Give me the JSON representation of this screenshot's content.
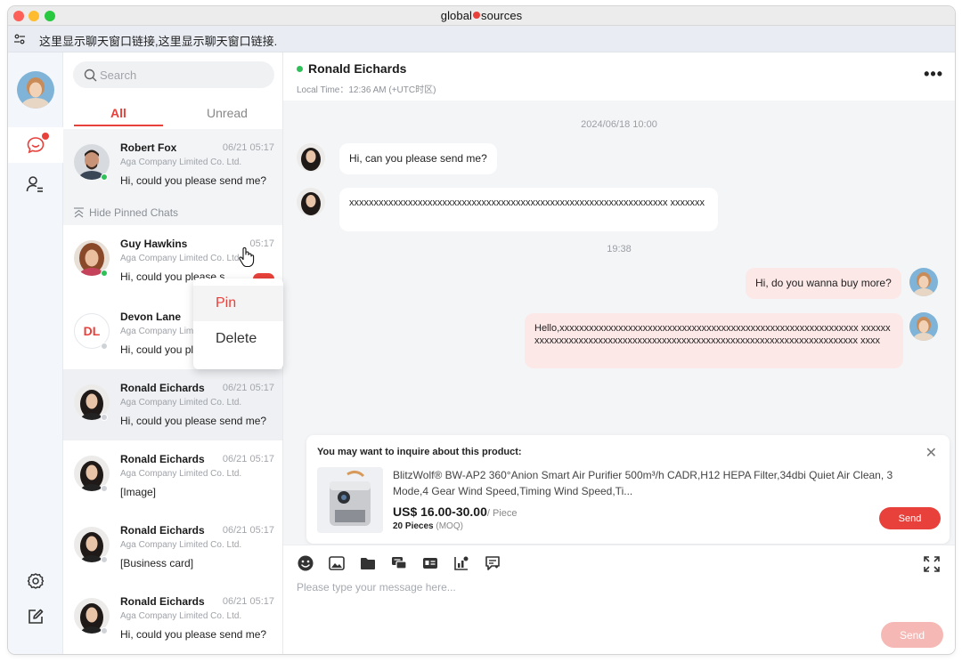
{
  "window": {
    "brand_left": "global",
    "brand_right": "sources"
  },
  "linkbar": {
    "text": "这里显示聊天窗口链接,这里显示聊天窗口链接."
  },
  "search": {
    "placeholder": "Search"
  },
  "tabs": {
    "all": "All",
    "unread": "Unread"
  },
  "pinned_chat": {
    "name": "Robert Fox",
    "time": "06/21 05:17",
    "company": "Aga Company Limited Co. Ltd.",
    "message": "Hi, could you please send me?",
    "status": "online"
  },
  "hide_pinned_label": "Hide Pinned Chats",
  "chats": [
    {
      "name": "Guy Hawkins",
      "time": "05:17",
      "company": "Aga Company Limited Co. Ltd.",
      "message": "Hi, could you please s...",
      "status": "online"
    },
    {
      "name": "Devon Lane",
      "time": "",
      "company": "Aga Company Lim",
      "message": "Hi, could you pl",
      "status": "offline",
      "initials": "DL"
    },
    {
      "name": "Ronald Eichards",
      "time": "06/21 05:17",
      "company": "Aga Company Limited Co. Ltd.",
      "message": "Hi, could you please send me?",
      "status": "offline"
    },
    {
      "name": "Ronald Eichards",
      "time": "06/21 05:17",
      "company": "Aga Company Limited Co. Ltd.",
      "message": "[Image]",
      "status": "offline"
    },
    {
      "name": "Ronald Eichards",
      "time": "06/21 05:17",
      "company": "Aga Company Limited Co. Ltd.",
      "message": "[Business card]",
      "status": "offline"
    },
    {
      "name": "Ronald Eichards",
      "time": "06/21 05:17",
      "company": "Aga Company Limited Co. Ltd.",
      "message": "Hi, could you please send me?",
      "status": "offline"
    }
  ],
  "context_menu": {
    "pin": "Pin",
    "delete": "Delete"
  },
  "conversation": {
    "name": "Ronald Eichards",
    "local_time": "Local Time：12:36 AM (+UTC时区)",
    "more": "•••",
    "stamp1": "2024/06/18 10:00",
    "stamp2": "19:38",
    "messages": [
      {
        "from": "them",
        "text": "Hi, can you please send me?"
      },
      {
        "from": "them",
        "text": "xxxxxxxxxxxxxxxxxxxxxxxxxxxxxxxxxxxxxxxxxxxxxxxxxxxxxxxxxxxxxxxxx xxxxxxx"
      },
      {
        "from": "me",
        "text": "Hi, do you wanna buy more?"
      },
      {
        "from": "me",
        "text": "Hello,xxxxxxxxxxxxxxxxxxxxxxxxxxxxxxxxxxxxxxxxxxxxxxxxxxxxxxxxxxxxx xxxxxxxxxxxxxxxxxxxxxxxxxxxxxxxxxxxxxxxxxxxxxxxxxxxxxxxxxxxxxxxxxxxxxxxx xxxx"
      }
    ]
  },
  "product": {
    "title": "You may want to inquire about this product:",
    "name": "BlitzWolf® BW-AP2 360°Anion Smart Air Purifier 500m³/h CADR,H12 HEPA Filter,34dbi Quiet Air Clean, 3 Mode,4 Gear Wind Speed,Timing Wind Speed,Ti...",
    "price": "US$ 16.00-30.00",
    "unit": "/ Piece",
    "moq_value": "20 Pieces",
    "moq_label": "(MOQ)",
    "send": "Send",
    "close": "✕"
  },
  "composer": {
    "placeholder": "Please type your message here...",
    "send": "Send"
  },
  "colors": {
    "accent": "#e8413b",
    "online": "#2fc05a",
    "outgoing_bubble": "#fde8e8"
  }
}
